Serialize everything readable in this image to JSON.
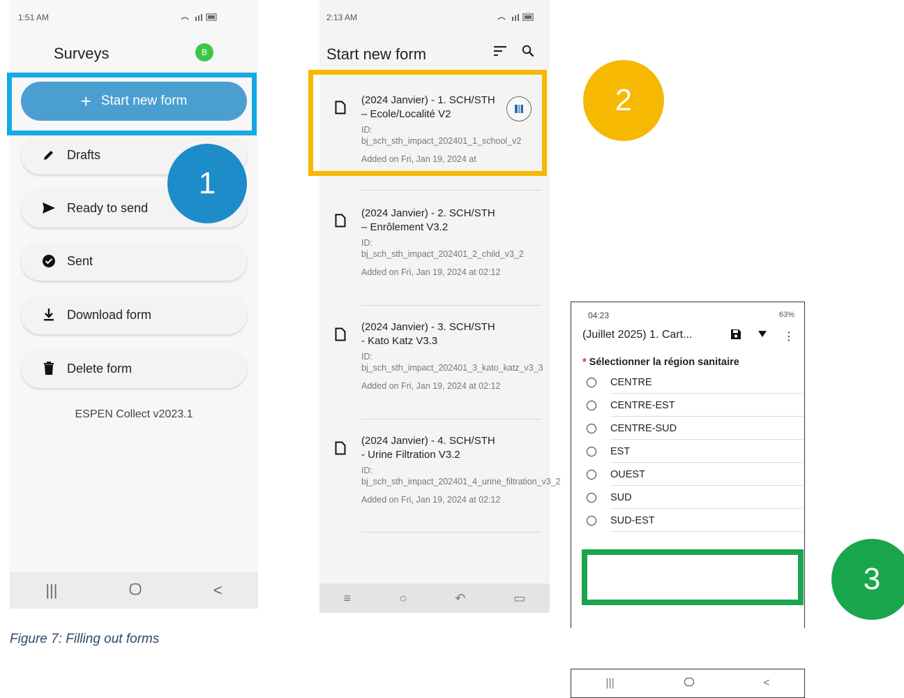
{
  "phone1": {
    "status_time": "1:51 AM",
    "status_right": "WiFi LTE",
    "title": "Surveys",
    "avatar": "B",
    "start_button": "Start new form",
    "menu": [
      {
        "label": "Drafts",
        "icon": "pencil-icon"
      },
      {
        "label": "Ready to send",
        "icon": "send-icon"
      },
      {
        "label": "Sent",
        "icon": "check-circle-icon"
      },
      {
        "label": "Download form",
        "icon": "download-icon"
      },
      {
        "label": "Delete form",
        "icon": "trash-icon"
      }
    ],
    "version": "ESPEN Collect v2023.1",
    "nav": [
      "|||",
      "○",
      "<"
    ]
  },
  "phone2": {
    "status_time": "2:13 AM",
    "status_right": "WiFi LTE",
    "title": "Start new form",
    "forms": [
      {
        "title": "(2024 Janvier) - 1. SCH/STH – Ecole/Localité V2",
        "id": "ID: bj_sch_sth_impact_202401_1_school_v2",
        "added": "Added on Fri, Jan 19, 2024 at"
      },
      {
        "title": "(2024 Janvier) - 2. SCH/STH – Enrôlement V3.2",
        "id": "ID: bj_sch_sth_impact_202401_2_child_v3_2",
        "added": "Added on Fri, Jan 19, 2024 at 02:12"
      },
      {
        "title": "(2024 Janvier) - 3. SCH/STH - Kato Katz V3.3",
        "id": "ID: bj_sch_sth_impact_202401_3_kato_katz_v3_3",
        "added": "Added on Fri, Jan 19, 2024 at 02:12"
      },
      {
        "title": "(2024 Janvier) - 4. SCH/STH - Urine Filtration V3.2",
        "id": "ID: bj_sch_sth_impact_202401_4_urine_filtration_v3_2",
        "added": "Added on Fri, Jan 19, 2024 at 02:12"
      }
    ]
  },
  "phone3": {
    "status_time": "04:23",
    "status_right": "63%",
    "title": "(Juillet 2025) 1. Cart...",
    "question": "Sélectionner la région sanitaire",
    "options": [
      "CENTRE",
      "CENTRE-EST",
      "CENTRE-SUD",
      "EST",
      "OUEST",
      "SUD",
      "SUD-EST"
    ]
  },
  "badges": {
    "one": "1",
    "two": "2",
    "three": "3"
  },
  "caption": "Figure 7: Filling out forms",
  "colors": {
    "blue_highlight": "#15a8e4",
    "yellow_highlight": "#f6b800",
    "green_highlight": "#1aa64c",
    "start_button": "#4a9fd0"
  }
}
